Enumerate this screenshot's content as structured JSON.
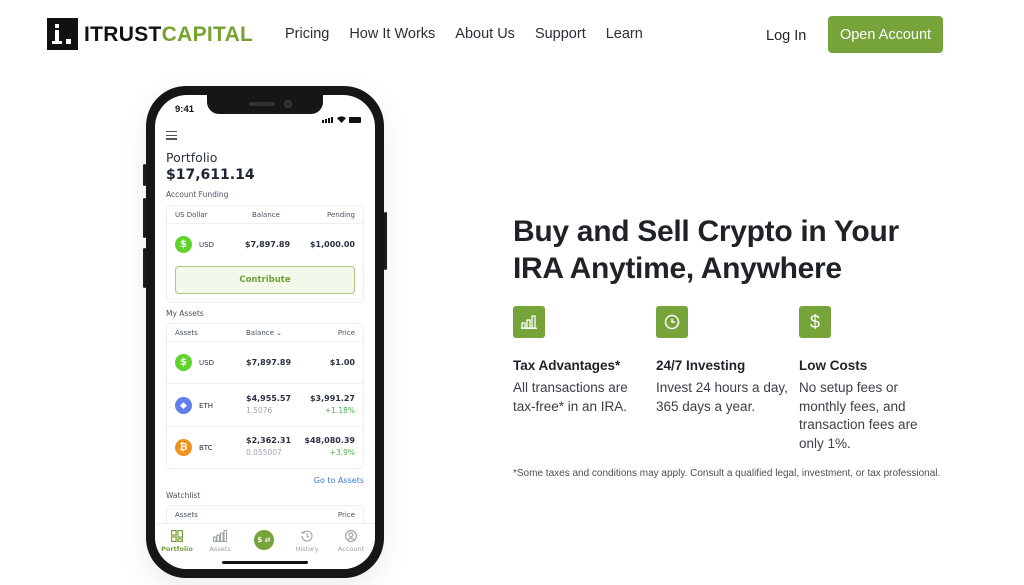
{
  "header": {
    "logo": {
      "part1": "ITRUST",
      "part2": "CAPITAL"
    },
    "nav": [
      "Pricing",
      "How It Works",
      "About Us",
      "Support",
      "Learn"
    ],
    "login_label": "Log In",
    "open_account_label": "Open Account",
    "accent_color": "#76a33a"
  },
  "phone": {
    "status_time": "9:41",
    "title": "Portfolio",
    "amount": "$17,611.14",
    "account_funding": {
      "label": "Account Funding",
      "headers": [
        "US Dollar",
        "Balance",
        "Pending"
      ],
      "row": {
        "symbol": "USD",
        "icon": "$",
        "balance": "$7,897.89",
        "pending": "$1,000.00"
      },
      "contribute_label": "Contribute"
    },
    "my_assets": {
      "label": "My Assets",
      "headers": [
        "Assets",
        "Balance",
        "Price"
      ],
      "rows": [
        {
          "symbol": "USD",
          "icon": "$",
          "color": "#5fd22b",
          "balance": "$7,897.89",
          "amount": "",
          "price": "$1.00",
          "change": ""
        },
        {
          "symbol": "ETH",
          "icon": "◆",
          "color": "#627eea",
          "balance": "$4,955.57",
          "amount": "1.5076",
          "price": "$3,991.27",
          "change": "+1.18%"
        },
        {
          "symbol": "BTC",
          "icon": "₿",
          "color": "#f2921b",
          "balance": "$2,362.31",
          "amount": "0.055007",
          "price": "$48,080.39",
          "change": "+3.9%"
        }
      ],
      "go_to_assets": "Go to Assets"
    },
    "watchlist": {
      "label": "Watchlist",
      "headers": [
        "Assets",
        "Price"
      ]
    },
    "bottom_nav": [
      {
        "label": "Portfolio",
        "icon": "grid-icon",
        "active": true
      },
      {
        "label": "Assets",
        "icon": "bar-chart-icon",
        "active": false
      },
      {
        "label": "$ ⇄",
        "icon": "transfer-icon",
        "active": false
      },
      {
        "label": "History",
        "icon": "history-icon",
        "active": false
      },
      {
        "label": "Account",
        "icon": "account-icon",
        "active": false
      }
    ]
  },
  "hero": {
    "title": "Buy and Sell Crypto in Your IRA Anytime, Anywhere",
    "features": [
      {
        "icon": "bar-chart-icon",
        "title": "Tax Advantages*",
        "desc": "All transactions are tax-free* in an IRA."
      },
      {
        "icon": "clock-icon",
        "title": "24/7 Investing",
        "desc": "Invest 24 hours a day, 365 days a year."
      },
      {
        "icon": "dollar-icon",
        "title": "Low Costs",
        "desc": "No setup fees or monthly fees, and transaction fees are only 1%."
      }
    ],
    "disclaimer": "*Some taxes and conditions may apply. Consult a qualified legal, investment, or tax professional."
  }
}
